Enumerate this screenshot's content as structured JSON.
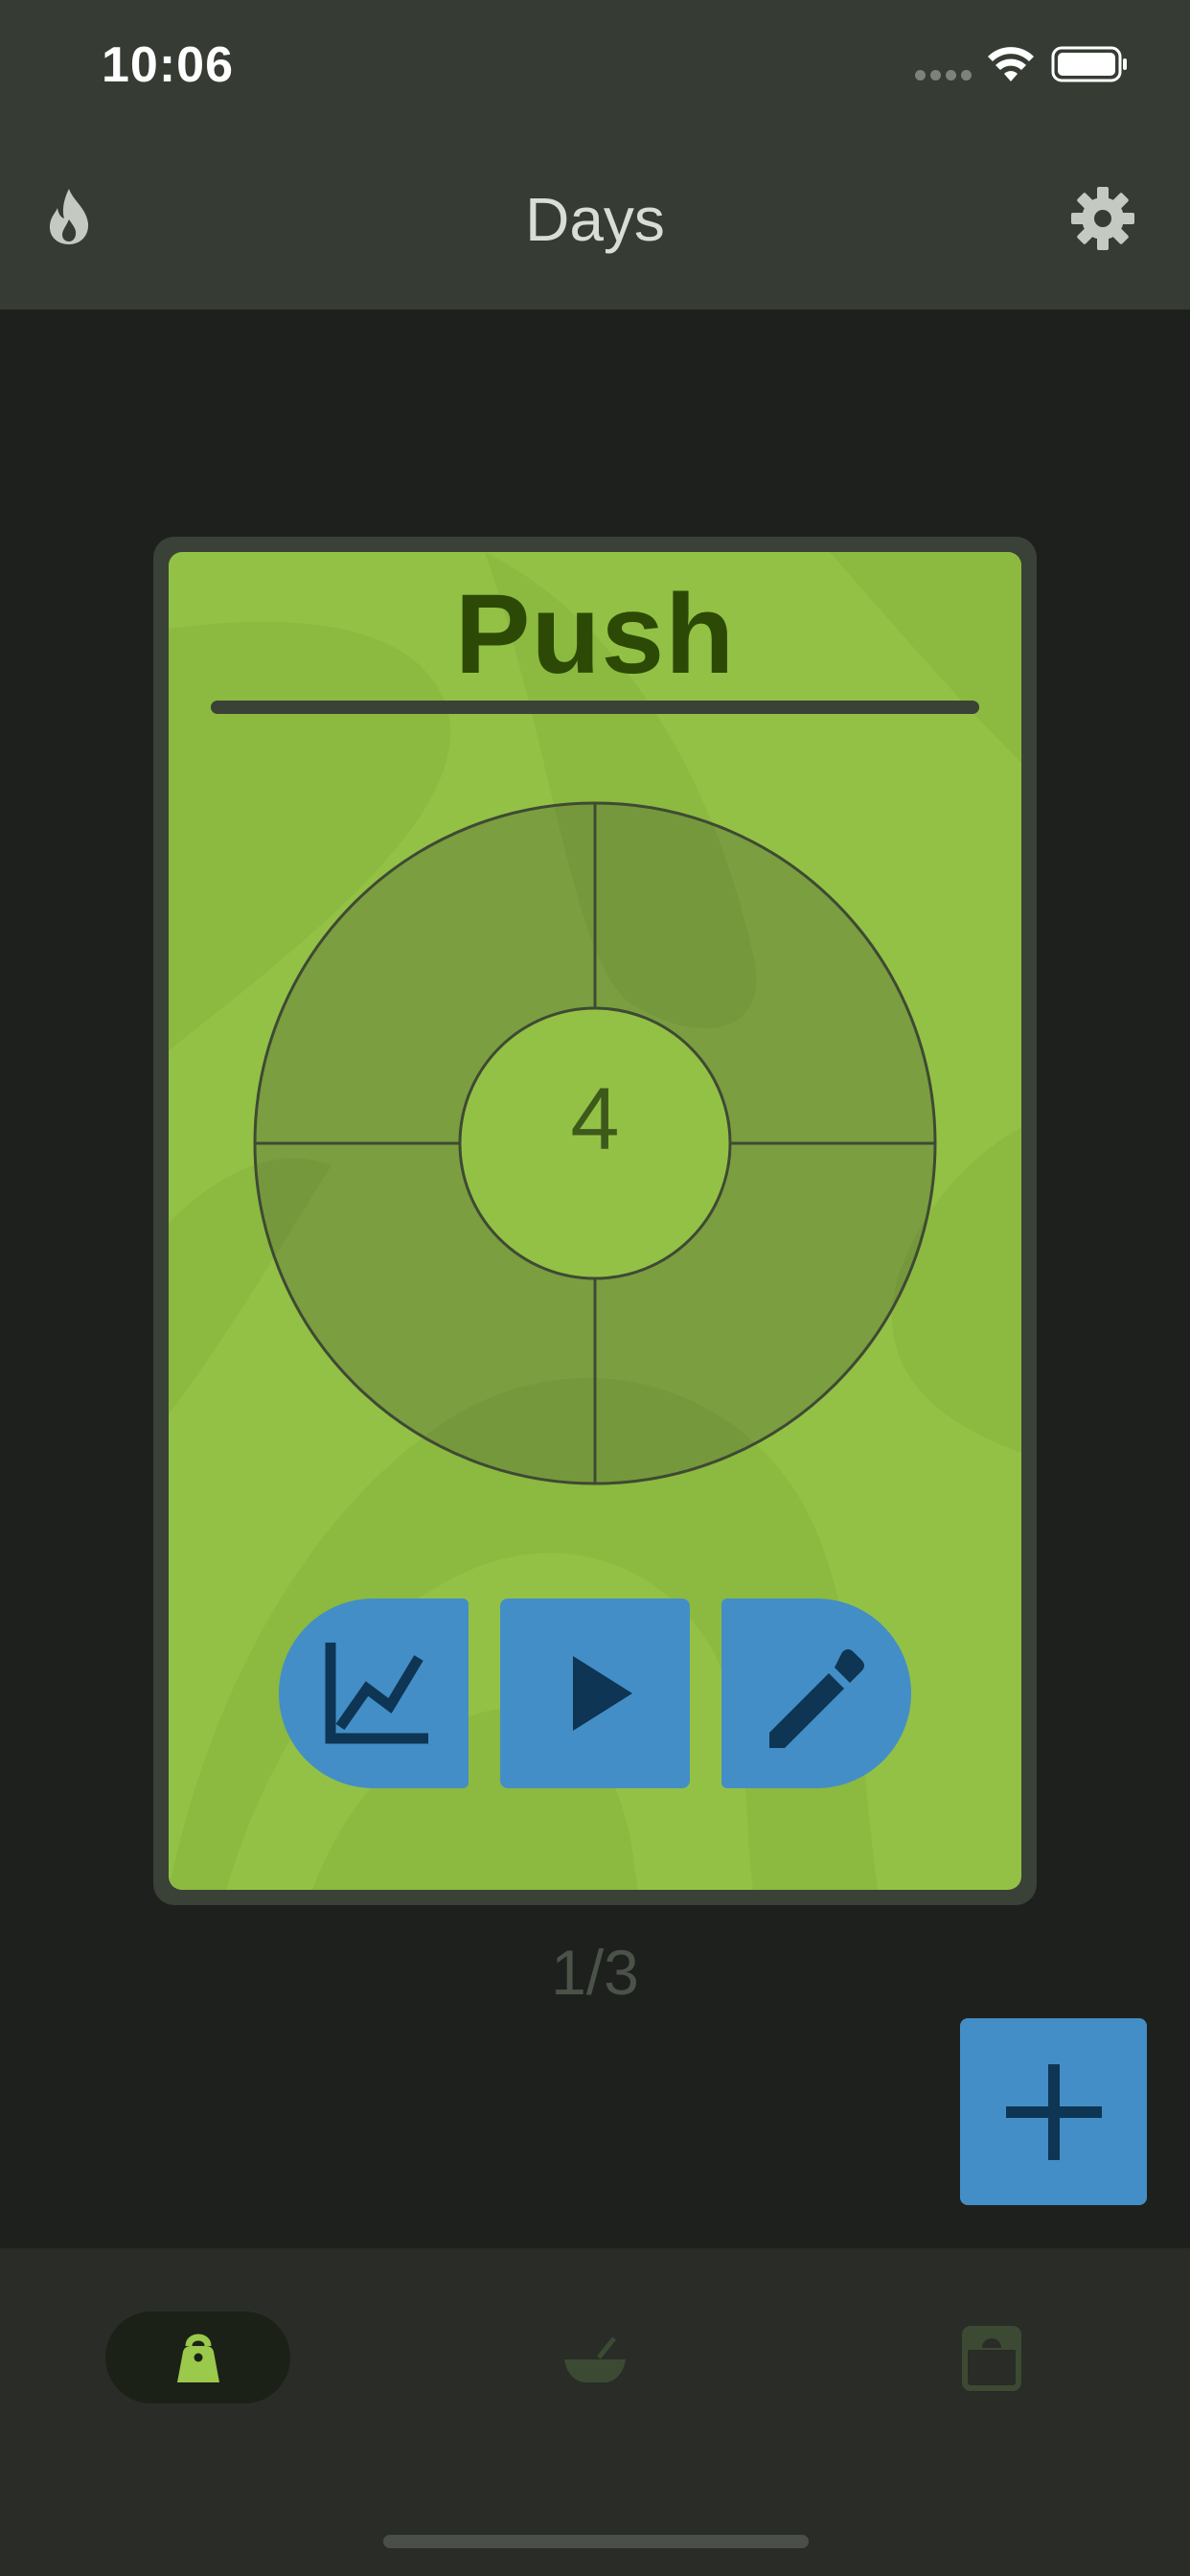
{
  "status_bar": {
    "time": "10:06"
  },
  "header": {
    "title": "Days"
  },
  "card": {
    "title": "Push",
    "count": "4",
    "actions": {
      "stats": "stats",
      "start": "start",
      "edit": "edit"
    }
  },
  "pager": {
    "text": "1/3"
  },
  "bottom_nav": {
    "items": [
      {
        "icon": "kettlebell-icon",
        "active": true
      },
      {
        "icon": "bowl-icon",
        "active": false
      },
      {
        "icon": "scale-icon",
        "active": false
      }
    ]
  },
  "colors": {
    "card_green": "#93c146",
    "button_blue": "#438ec6",
    "title_green": "#2c4a06",
    "app_bar": "#363b34",
    "background": "#1e201e"
  }
}
